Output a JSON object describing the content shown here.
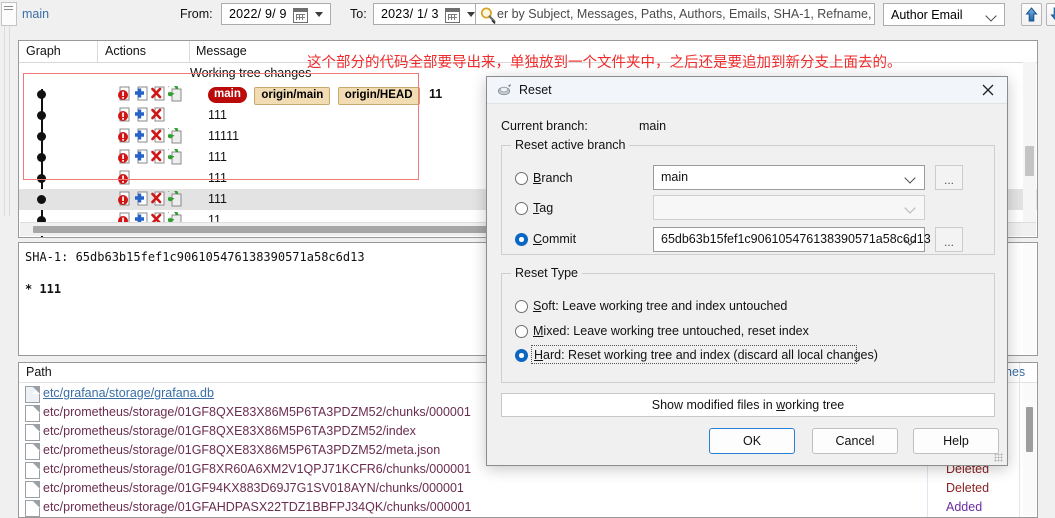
{
  "toolbar": {
    "tab_label": "main",
    "from_label": "From:",
    "from_value": "2022/ 9/ 9",
    "to_label": "To:",
    "to_value": "2023/ 1/ 3",
    "search_placeholder": "er by Subject, Messages, Paths, Authors, Emails, SHA-1, Refname, I",
    "search_value": "",
    "author_select_value": "Author Email",
    "up_button": "up-arrow",
    "down_button": "down-arrow"
  },
  "graph_panel": {
    "columns": [
      "Graph",
      "Actions",
      "Message"
    ],
    "annotation": "这个部分的代码全部要导出来，单独放到一个文件夹中，之后还是要追加到新分支上面去的。",
    "working_tree_row": "Working tree changes",
    "rows": [
      {
        "message": "11",
        "refs": [
          {
            "text": "main",
            "kind": "head"
          },
          {
            "text": "origin/main",
            "kind": "remote"
          },
          {
            "text": "origin/HEAD",
            "kind": "remote"
          }
        ],
        "icons": [
          "info-icon",
          "add-icon",
          "delete-icon",
          "revert-icon"
        ],
        "selected": false
      },
      {
        "message": "111",
        "refs": [],
        "icons": [
          "info-icon",
          "add-icon",
          "delete-icon"
        ],
        "selected": false
      },
      {
        "message": "11111",
        "refs": [],
        "icons": [
          "info-icon",
          "add-icon",
          "delete-icon",
          "revert-icon"
        ],
        "selected": false
      },
      {
        "message": "111",
        "refs": [],
        "icons": [
          "info-icon",
          "add-icon",
          "delete-icon",
          "revert-icon"
        ],
        "selected": false
      },
      {
        "message": "111",
        "refs": [],
        "icons": [
          "info-icon"
        ],
        "selected": false
      },
      {
        "message": "111",
        "refs": [],
        "icons": [
          "info-icon",
          "add-icon",
          "delete-icon",
          "revert-icon"
        ],
        "selected": true
      },
      {
        "message": "11",
        "refs": [],
        "icons": [
          "info-icon",
          "add-icon",
          "delete-icon",
          "revert-icon"
        ],
        "selected": false
      }
    ]
  },
  "sha_panel": {
    "sha_line": "SHA-1: 65db63b15fef1c906105476138390571a58c6d13",
    "body_line": "* 111"
  },
  "path_panel": {
    "columns": [
      "Path",
      "nes"
    ],
    "rows": [
      {
        "path": "etc/grafana/storage/grafana.db",
        "style": "link",
        "icon": "modified-file-icon",
        "status": ""
      },
      {
        "path": "etc/prometheus/storage/01GF8QXE83X86M5P6TA3PDZM52/chunks/000001",
        "style": "plain",
        "icon": "file-icon",
        "status": ""
      },
      {
        "path": "etc/prometheus/storage/01GF8QXE83X86M5P6TA3PDZM52/index",
        "style": "plain",
        "icon": "file-icon",
        "status": ""
      },
      {
        "path": "etc/prometheus/storage/01GF8QXE83X86M5P6TA3PDZM52/meta.json",
        "style": "plain",
        "icon": "file-icon",
        "status": ""
      },
      {
        "path": "etc/prometheus/storage/01GF8XR60A6XM2V1QPJ71KCFR6/chunks/000001",
        "style": "plain",
        "icon": "file-icon",
        "status": "Deleted"
      },
      {
        "path": "etc/prometheus/storage/01GF94KX883D69J7G1SV018AYN/chunks/000001",
        "style": "plain",
        "icon": "file-icon",
        "status": "Deleted"
      },
      {
        "path": "etc/prometheus/storage/01GFAHDPASX22TDZ1BBFPJ34QK/chunks/000001",
        "style": "plain",
        "icon": "file-icon",
        "status": "Added"
      }
    ]
  },
  "dialog": {
    "title": "Reset",
    "close_label": "×",
    "current_branch_label": "Current branch:",
    "current_branch_value": "main",
    "group_branch_label": "Reset active branch",
    "branch_radio_label_pre": "B",
    "branch_radio_label_post": "ranch",
    "branch_value": "main",
    "tag_radio_label_pre": "T",
    "tag_radio_label_post": "ag",
    "tag_value": "",
    "commit_radio_label_pre": "C",
    "commit_radio_label_post": "ommit",
    "commit_value": "65db63b15fef1c906105476138390571a58c6d13",
    "browse_label": "...",
    "group_type_label": "Reset Type",
    "soft_pre": "S",
    "soft_post": "oft: Leave working tree and index untouched",
    "mixed_pre": "M",
    "mixed_post": "ixed: Leave working tree untouched, reset index",
    "hard_pre": "H",
    "hard_post": "ard: Reset working tree and index (discard all local changes)",
    "show_modified_pre": "Show modified files in ",
    "show_modified_key": "w",
    "show_modified_post": "orking tree",
    "ok_label": "OK",
    "cancel_label": "Cancel",
    "help_label": "Help",
    "selected_branch_option": "commit",
    "selected_reset_type": "hard"
  },
  "colors": {
    "head_badge": "#bb0a0a",
    "remote_badge": "#f2dcb3",
    "annotation": "#ef2b2b",
    "accent": "#0b67c4",
    "link": "#3a6ea5"
  }
}
